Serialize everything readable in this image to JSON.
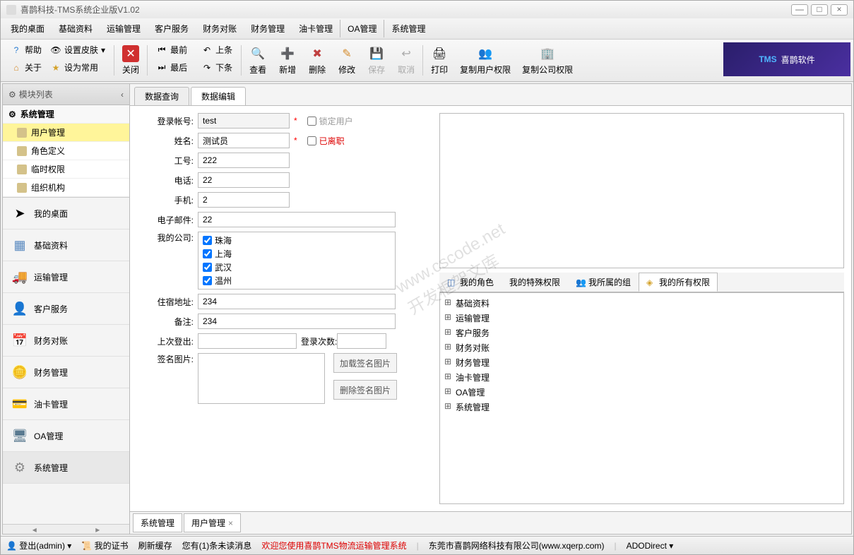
{
  "window": {
    "title": "喜鹊科技-TMS系统企业版V1.02"
  },
  "menu": [
    "我的桌面",
    "基础资料",
    "运输管理",
    "客户服务",
    "财务对账",
    "财务管理",
    "油卡管理",
    "OA管理",
    "系统管理"
  ],
  "toolbar": {
    "help": "帮助",
    "skin": "设置皮肤",
    "about": "关于",
    "setCommon": "设为常用",
    "close": "关闭",
    "first": "最前",
    "last": "最后",
    "prev": "上条",
    "next": "下条",
    "view": "查看",
    "add": "新增",
    "delete": "删除",
    "edit": "修改",
    "save": "保存",
    "cancel": "取消",
    "print": "打印",
    "copyUser": "复制用户权限",
    "copyCompany": "复制公司权限",
    "logo": "喜鹊软件"
  },
  "sidebar": {
    "header": "模块列表",
    "treeRoot": "系统管理",
    "tree": [
      "用户管理",
      "角色定义",
      "临时权限",
      "组织机构"
    ],
    "nav": [
      "我的桌面",
      "基础资料",
      "运输管理",
      "客户服务",
      "财务对账",
      "财务管理",
      "油卡管理",
      "OA管理",
      "系统管理"
    ]
  },
  "mainTabs": {
    "query": "数据查询",
    "edit": "数据编辑"
  },
  "form": {
    "labels": {
      "account": "登录帐号:",
      "name": "姓名:",
      "empNo": "工号:",
      "phone": "电话:",
      "mobile": "手机:",
      "email": "电子邮件:",
      "company": "我的公司:",
      "address": "住宿地址:",
      "remark": "备注:",
      "lastLogin": "上次登出:",
      "loginCount": "登录次数:",
      "signature": "签名图片:"
    },
    "values": {
      "account": "test",
      "name": "测试员",
      "empNo": "222",
      "phone": "22",
      "mobile": "2",
      "email": "22",
      "address": "234",
      "remark": "234",
      "lastLogin": "",
      "loginCount": ""
    },
    "locked": "锁定用户",
    "resigned": "已离职",
    "companies": [
      "珠海",
      "上海",
      "武汉",
      "温州"
    ],
    "loadSig": "加载签名图片",
    "delSig": "删除签名图片"
  },
  "rightTabs": [
    "我的角色",
    "我的特殊权限",
    "我所属的组",
    "我的所有权限"
  ],
  "permTree": [
    "基础资料",
    "运输管理",
    "客户服务",
    "财务对账",
    "财务管理",
    "油卡管理",
    "OA管理",
    "系统管理"
  ],
  "bottomTabs": [
    "系统管理",
    "用户管理"
  ],
  "status": {
    "logout": "登出(admin)",
    "cert": "我的证书",
    "refresh": "刷新缓存",
    "unread": "您有(1)条未读消息",
    "welcome": "欢迎您使用喜鹊TMS物流运输管理系统",
    "company": "东莞市喜鹊网络科技有限公司(www.xqerp.com)",
    "ado": "ADODirect"
  },
  "watermark": "www.cscode.net\n开发框架文库"
}
